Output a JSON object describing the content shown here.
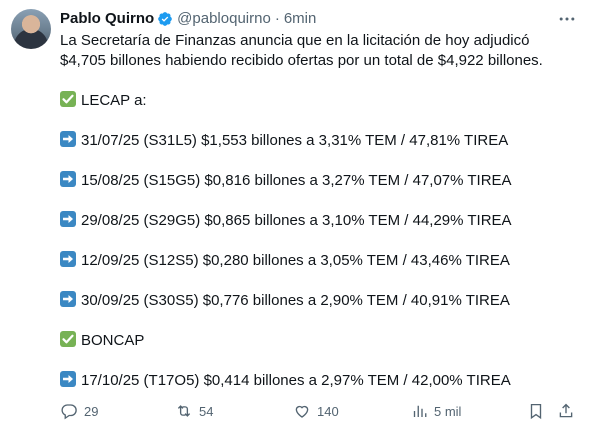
{
  "tweet": {
    "author_name": "Pablo Quirno",
    "handle": "@pabloquirno",
    "separator": "·",
    "time": "6min",
    "intro_line1": "La Secretaría de Finanzas anuncia que en la licitación de hoy adjudicó",
    "intro_line2": "$4,705 billones habiendo recibido ofertas por un total de $4,922 billones.",
    "lecap_header": "LECAP a:",
    "lecap_items": [
      "31/07/25 (S31L5) $1,553 billones a 3,31% TEM / 47,81% TIREA",
      "15/08/25 (S15G5) $0,816 billones a 3,27% TEM / 47,07% TIREA",
      "29/08/25 (S29G5) $0,865 billones a 3,10% TEM / 44,29% TIREA",
      "12/09/25 (S12S5) $0,280 billones a 3,05% TEM / 43,46% TIREA",
      "30/09/25 (S30S5) $0,776 billones a 2,90% TEM / 40,91% TIREA"
    ],
    "boncap_header": "BONCAP",
    "boncap_items": [
      "17/10/25 (T17O5) $0,414 billones a 2,97% TEM / 42,00% TIREA"
    ]
  },
  "actions": {
    "replies": "29",
    "reposts": "54",
    "likes": "140",
    "views": "5 mil"
  },
  "colors": {
    "verified": "#1d9bf0",
    "check_emoji": "#77b255",
    "arrow_emoji": "#3b88c3",
    "secondary_text": "#536471"
  }
}
